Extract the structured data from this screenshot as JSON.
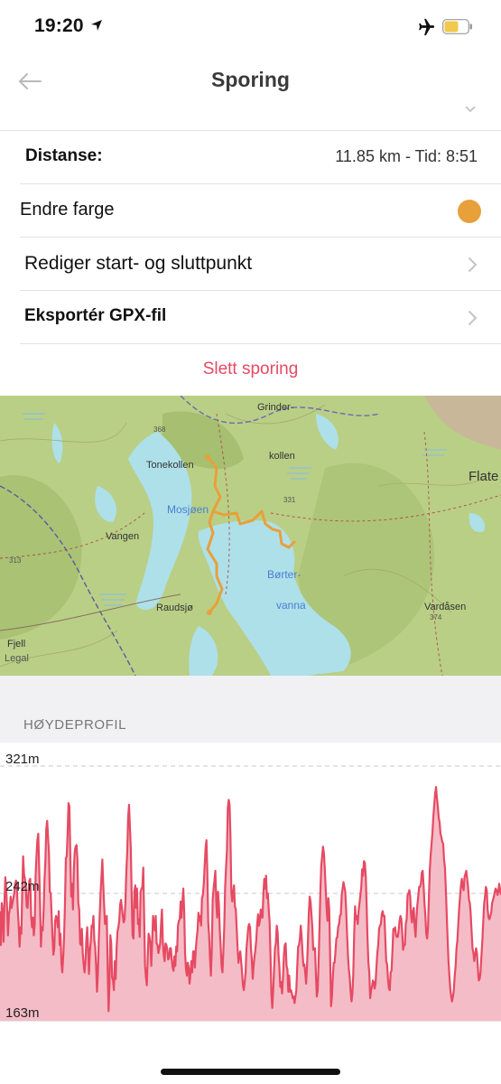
{
  "status": {
    "time": "19:20",
    "location_icon": "location-arrow-icon",
    "airplane_icon": "airplane-icon",
    "battery_icon": "battery-icon",
    "battery_color": "#f2c94c",
    "battery_level": 0.6
  },
  "nav": {
    "title": "Sporing",
    "back_icon": "back-arrow-icon"
  },
  "rows": {
    "distance_label": "Distanse:",
    "distance_value": "11.85 km - Tid: 8:51",
    "color_label": "Endre farge",
    "color_value": "#e8a03a",
    "edit_label": "Rediger start- og sluttpunkt",
    "export_label": "Eksportér GPX-fil"
  },
  "delete_label": "Slett sporing",
  "map": {
    "labels": {
      "grinder": "Grinder-",
      "kollen": "kollen",
      "tonekollen": "Tonekollen",
      "mosjoen": "Mosjøen",
      "vangen": "Vangen",
      "borter": "Børter-",
      "vanna": "vanna",
      "raudsjo": "Raudsjø",
      "vardasen": "Vardåsen",
      "flate": "Flate",
      "fjell": "Fjell",
      "legal": "Legal",
      "h368": "368",
      "h331": "331",
      "h313": "313",
      "h374": "374"
    },
    "track_color": "#e8a03a"
  },
  "profile": {
    "section_title": "HØYDEPROFIL",
    "line_color": "#e64a63",
    "fill_color": "#f4bcc6"
  },
  "chart_data": {
    "type": "area",
    "title": "",
    "xlabel": "",
    "ylabel": "",
    "ylim": [
      163,
      321
    ],
    "y_ticks": [
      "321m",
      "242m",
      "163m"
    ],
    "grid": true,
    "values": [
      231,
      210,
      236,
      231,
      212,
      237,
      252,
      245,
      232,
      216,
      229,
      232,
      240,
      233,
      236,
      239,
      242,
      248,
      250,
      245,
      232,
      222,
      209,
      221,
      217,
      244,
      265,
      254,
      251,
      246,
      234,
      233,
      243,
      250,
      251,
      228,
      221,
      227,
      216,
      223,
      253,
      265,
      275,
      279,
      258,
      236,
      209,
      221,
      219,
      231,
      250,
      262,
      282,
      287,
      277,
      267,
      243,
      242,
      229,
      215,
      204,
      208,
      225,
      228,
      226,
      221,
      231,
      210,
      217,
      199,
      193,
      202,
      215,
      235,
      264,
      265,
      280,
      298,
      296,
      266,
      240,
      248,
      232,
      257,
      268,
      271,
      272,
      263,
      236,
      232,
      211,
      210,
      220,
      205,
      198,
      193,
      199,
      213,
      221,
      208,
      192,
      206,
      212,
      222,
      221,
      228,
      213,
      209,
      197,
      181,
      192,
      213,
      228,
      242,
      252,
      263,
      248,
      235,
      223,
      223,
      228,
      195,
      169,
      185,
      216,
      211,
      190,
      188,
      182,
      200,
      189,
      208,
      218,
      221,
      225,
      235,
      238,
      233,
      228,
      224,
      226,
      238,
      256,
      268,
      289,
      297,
      283,
      270,
      240,
      216,
      214,
      243,
      247,
      233,
      245,
      223,
      226,
      215,
      243,
      245,
      246,
      258,
      227,
      197,
      190,
      185,
      202,
      217,
      215,
      211,
      197,
      212,
      228,
      223,
      219,
      228,
      211,
      210,
      205,
      208,
      211,
      223,
      232,
      212,
      204,
      200,
      211,
      210,
      207,
      201,
      202,
      208,
      208,
      201,
      196,
      194,
      203,
      197,
      209,
      206,
      222,
      225,
      226,
      237,
      227,
      237,
      245,
      231,
      205,
      195,
      191,
      199,
      196,
      186,
      192,
      200,
      193,
      206,
      206,
      196,
      207,
      214,
      219,
      230,
      225,
      228,
      222,
      239,
      241,
      248,
      259,
      270,
      275,
      255,
      224,
      216,
      202,
      191,
      207,
      238,
      245,
      250,
      256,
      237,
      227,
      243,
      235,
      219,
      209,
      197,
      193,
      206,
      221,
      246,
      258,
      268,
      295,
      300,
      297,
      277,
      242,
      237,
      243,
      247,
      234,
      232,
      220,
      208,
      199,
      203,
      206,
      200,
      193,
      185,
      182,
      187,
      193,
      208,
      214,
      221,
      223,
      221,
      208,
      201,
      189,
      197,
      203,
      207,
      213,
      223,
      229,
      222,
      225,
      232,
      227,
      227,
      242,
      251,
      245,
      253,
      239,
      242,
      232,
      224,
      203,
      179,
      171,
      182,
      195,
      208,
      211,
      222,
      218,
      204,
      196,
      184,
      187,
      180,
      190,
      203,
      210,
      211,
      197,
      195,
      181,
      191,
      181,
      182,
      180,
      177,
      178,
      174,
      178,
      182,
      196,
      209,
      210,
      214,
      222,
      215,
      205,
      197,
      198,
      193,
      186,
      197,
      212,
      229,
      240,
      237,
      229,
      221,
      207,
      208,
      208,
      192,
      178,
      182,
      199,
      220,
      243,
      259,
      265,
      271,
      267,
      257,
      245,
      233,
      225,
      239,
      232,
      203,
      172,
      178,
      190,
      199,
      199,
      206,
      214,
      215,
      221,
      223,
      228,
      229,
      241,
      245,
      249,
      246,
      243,
      232,
      217,
      204,
      195,
      190,
      181,
      175,
      180,
      192,
      216,
      234,
      226,
      228,
      223,
      231,
      236,
      241,
      246,
      257,
      253,
      262,
      261,
      253,
      235,
      214,
      199,
      193,
      177,
      182,
      184,
      188,
      187,
      183,
      186,
      196,
      205,
      210,
      220,
      222,
      223,
      229,
      231,
      228,
      228,
      214,
      200,
      198,
      189,
      183,
      182,
      193,
      194,
      206,
      220,
      219,
      221,
      216,
      215,
      215,
      219,
      225,
      228,
      226,
      218,
      207,
      210,
      210,
      223,
      226,
      241,
      242,
      244,
      240,
      228,
      224,
      231,
      233,
      221,
      215,
      227,
      235,
      240,
      246,
      246,
      248,
      255,
      256,
      247,
      236,
      228,
      217,
      214,
      221,
      240,
      257,
      266,
      273,
      280,
      290,
      297,
      304,
      308,
      301,
      296,
      289,
      286,
      279,
      277,
      274,
      273,
      263,
      258,
      245,
      229,
      214,
      200,
      191,
      183,
      178,
      175,
      178,
      182,
      191,
      197,
      208,
      213,
      223,
      233,
      240,
      247,
      251,
      246,
      244,
      252,
      254,
      256,
      251,
      246,
      238,
      236,
      229,
      218,
      208,
      205,
      200,
      204,
      208,
      205,
      196,
      188,
      189,
      193,
      203,
      212,
      224,
      235,
      240,
      246,
      244,
      232,
      227,
      226,
      228,
      230,
      236,
      238,
      240,
      243,
      245,
      244,
      241,
      243,
      248,
      244,
      241
    ]
  }
}
